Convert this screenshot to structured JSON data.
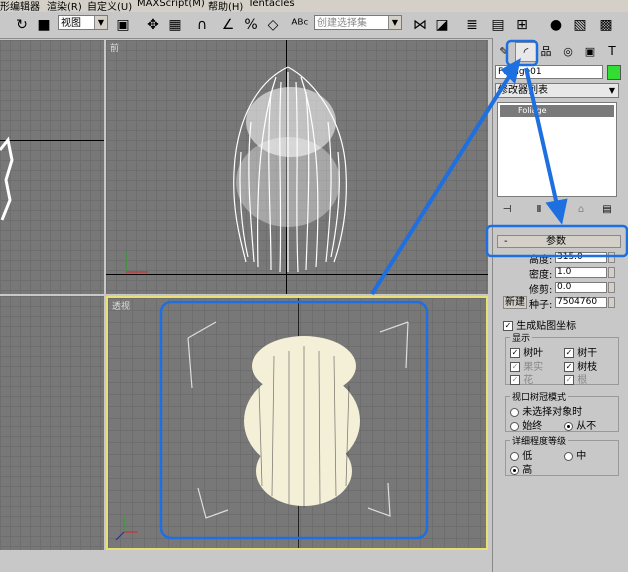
{
  "menu": {
    "items": [
      "形编辑器",
      "渲染(R)",
      "自定义(U)",
      "MAXScript(M)",
      "帮助(H)",
      "Tentacles"
    ]
  },
  "toolbar": {
    "view_dropdown": "视图",
    "selection_set_placeholder": "创建选择集"
  },
  "viewports": {
    "front_label": "前",
    "perspective_label": "透视"
  },
  "panel": {
    "object_name": "Foliage01",
    "modifier_list": "修改器列表",
    "stack_item": "Foliage",
    "rollout_title": "参数",
    "rollout_toggle": "-",
    "params": [
      {
        "label": "高度:",
        "value": "315.0"
      },
      {
        "label": "密度:",
        "value": "1.0"
      },
      {
        "label": "修剪:",
        "value": "0.0"
      }
    ],
    "new_button": "新建",
    "seed_label": "种子:",
    "seed_value": "7504760",
    "gen_mapping": "生成贴图坐标",
    "display_group": {
      "title": "显示",
      "items": [
        {
          "label": "树叶",
          "checked": true
        },
        {
          "label": "树干",
          "checked": true
        },
        {
          "label": "果实",
          "checked": true
        },
        {
          "label": "树枝",
          "checked": true
        },
        {
          "label": "花",
          "checked": true
        },
        {
          "label": "根",
          "checked": true
        }
      ]
    },
    "canopy_group": {
      "title": "视口树冠模式",
      "opt1": "未选择对象时",
      "opt2": "始终",
      "opt3": "从不",
      "selected": "从不"
    },
    "detail_group": {
      "title": "详细程度等级",
      "low": "低",
      "mid": "中",
      "high": "高",
      "selected": "高"
    }
  },
  "colors": {
    "viewport_bg": "#787878",
    "active_border": "#e8e070",
    "annotation": "#1e6fe0",
    "object_swatch": "#33dd33"
  }
}
